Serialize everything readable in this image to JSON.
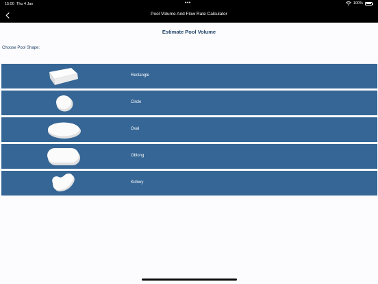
{
  "status_bar": {
    "time": "15:00",
    "date": "Thu 4 Jan",
    "dots": "•••",
    "battery": "100%"
  },
  "nav": {
    "title": "Pool Volume And Flow Rate Calculator"
  },
  "page": {
    "title": "Estimate Pool Volume",
    "prompt": "Choose Pool Shape:"
  },
  "shapes": [
    {
      "name": "Rectangle",
      "icon": "rectangle-pool-icon"
    },
    {
      "name": "Circle",
      "icon": "circle-pool-icon"
    },
    {
      "name": "Oval",
      "icon": "oval-pool-icon"
    },
    {
      "name": "Oblong",
      "icon": "oblong-pool-icon"
    },
    {
      "name": "Kidney",
      "icon": "kidney-pool-icon"
    }
  ],
  "colors": {
    "row_background": "#356695",
    "title_text": "#1e3f66",
    "bar_background": "#000000"
  }
}
